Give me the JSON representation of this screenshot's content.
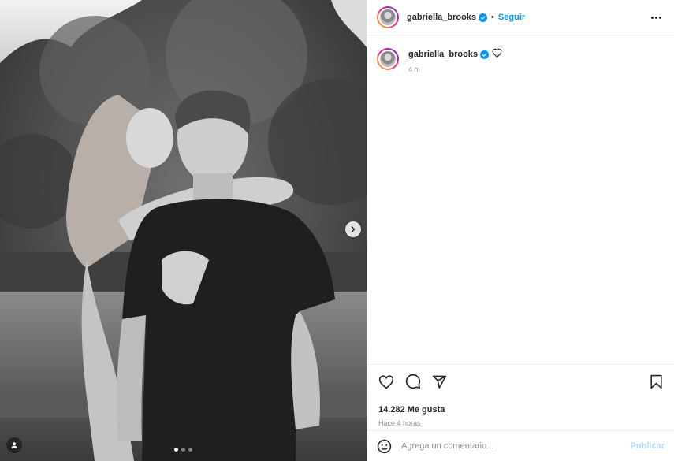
{
  "post": {
    "username": "gabriella_brooks",
    "follow_label": "Seguir",
    "separator": "•",
    "caption_time": "4 h",
    "likes": "14.282 Me gusta",
    "posted_ago": "Hace 4 horas",
    "media": {
      "description_icon": "photo",
      "carousel_total": 3,
      "carousel_current": 1
    }
  },
  "comment": {
    "placeholder": "Agrega un comentario...",
    "publish_label": "Publicar"
  },
  "colors": {
    "accent": "#0095f6",
    "publish_disabled": "#b3dbff",
    "muted_text": "#8e8e8e",
    "border": "#efefef"
  },
  "icons": {
    "header_more": "more-horizontal-icon",
    "like": "heart-icon",
    "comment": "comment-icon",
    "share": "send-icon",
    "save": "bookmark-icon",
    "emoji": "emoji-icon",
    "verified": "verified-badge-icon",
    "next": "chevron-right-icon",
    "tags": "user-tag-icon"
  }
}
